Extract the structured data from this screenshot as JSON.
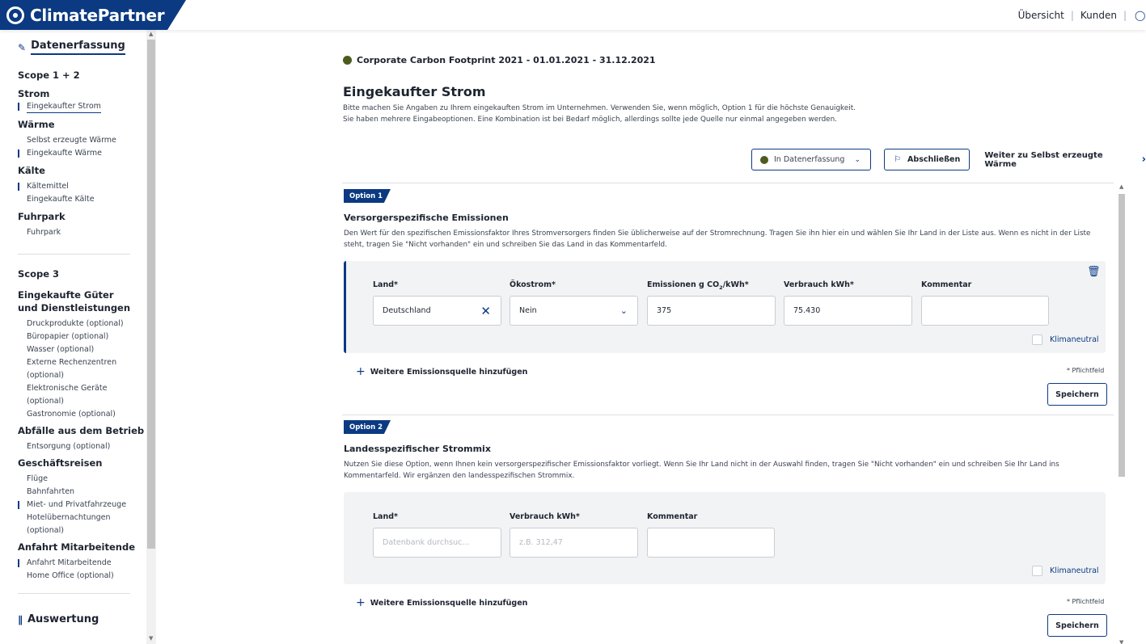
{
  "brand": {
    "name": "ClimatePartner",
    "color": "#0b3a82"
  },
  "topnav": {
    "overview": "Übersicht",
    "customers": "Kunden",
    "user_icon": "user-icon"
  },
  "sidebar": {
    "header": "Datenerfassung",
    "scope12": "Scope 1 + 2",
    "groups12": [
      {
        "label": "Strom",
        "items": [
          {
            "label": "Eingekaufter Strom"
          }
        ]
      },
      {
        "label": "Wärme",
        "items": [
          {
            "label": "Selbst erzeugte Wärme"
          },
          {
            "label": "Eingekaufte Wärme"
          }
        ]
      },
      {
        "label": "Kälte",
        "items": [
          {
            "label": "Kältemittel"
          },
          {
            "label": "Eingekaufte Kälte"
          }
        ]
      },
      {
        "label": "Fuhrpark",
        "items": [
          {
            "label": "Fuhrpark"
          }
        ]
      }
    ],
    "scope3": "Scope 3",
    "group_goods": "Eingekaufte Güter und Dienstleistungen",
    "goods_items": [
      "Druckprodukte (optional)",
      "Büropapier (optional)",
      "Wasser (optional)",
      "Externe Rechenzentren (optional)",
      "Elektronische Geräte (optional)",
      "Gastronomie (optional)"
    ],
    "group_waste": "Abfälle aus dem Betrieb",
    "waste_item": "Entsorgung (optional)",
    "group_travel": "Geschäftsreisen",
    "travel_items": [
      "Flüge",
      "Bahnfahrten",
      "Miet- und Privatfahrzeuge",
      "Hotelübernachtungen (optional)"
    ],
    "group_commute": "Anfahrt Mitarbeitende",
    "commute_items": [
      "Anfahrt Mitarbeitende",
      "Home Office (optional)"
    ],
    "evaluation": "Auswertung"
  },
  "main": {
    "footprint": "Corporate Carbon Footprint 2021 - 01.01.2021 - 31.12.2021",
    "status_color": "#4d5b1f",
    "title": "Eingekaufter Strom",
    "desc1": "Bitte machen Sie Angaben zu Ihrem eingekauften Strom im Unternehmen. Verwenden Sie, wenn möglich, Option 1 für die höchste Genauigkeit.",
    "desc2": "Sie haben mehrere Eingabeoptionen. Eine Kombination ist bei Bedarf möglich, allerdings sollte jede Quelle nur einmal angegeben werden.",
    "status_label": "In Datenerfassung",
    "finish_label": "Abschließen",
    "next_label": "Weiter zu Selbst erzeugte Wärme"
  },
  "option1": {
    "badge": "Option 1",
    "title": "Versorgerspezifische Emissionen",
    "desc": "Den Wert für den spezifischen Emissionsfaktor Ihres Stromversorgers finden Sie üblicherweise auf der Stromrechnung. Tragen Sie ihn hier ein und wählen Sie Ihr Land in der Liste aus. Wenn es nicht in der Liste steht, tragen Sie \"Nicht vorhanden\" ein und schreiben Sie das Land in das Kommentarfeld.",
    "label_country": "Land*",
    "label_green": "Ökostrom*",
    "label_emissions_pre": "Emissionen g CO",
    "label_emissions_sub": "2",
    "label_emissions_post": "/kWh*",
    "label_consumption": "Verbrauch kWh*",
    "label_comment": "Kommentar",
    "value_country": "Deutschland",
    "value_green": "Nein",
    "value_emissions": "375",
    "value_consumption": "75.430",
    "value_comment": "",
    "climate_neutral": "Klimaneutral",
    "add": "Weitere Emissionsquelle hinzufügen",
    "required": "* Pflichtfeld",
    "save": "Speichern"
  },
  "option2": {
    "badge": "Option 2",
    "title": "Landesspezifischer Strommix",
    "desc": "Nutzen Sie diese Option, wenn Ihnen kein versorgerspezifischer Emissionsfaktor vorliegt. Wenn Sie Ihr Land nicht in der Auswahl finden, tragen Sie \"Nicht vorhanden\" ein und schreiben Sie Ihr Land ins Kommentarfeld. Wir ergänzen den landesspezifischen Strommix.",
    "label_country": "Land*",
    "label_consumption": "Verbrauch kWh*",
    "label_comment": "Kommentar",
    "ph_country": "Datenbank durchsuc...",
    "ph_consumption": "z.B. 312,47",
    "value_comment": "",
    "climate_neutral": "Klimaneutral",
    "add": "Weitere Emissionsquelle hinzufügen",
    "required": "* Pflichtfeld",
    "save": "Speichern"
  }
}
